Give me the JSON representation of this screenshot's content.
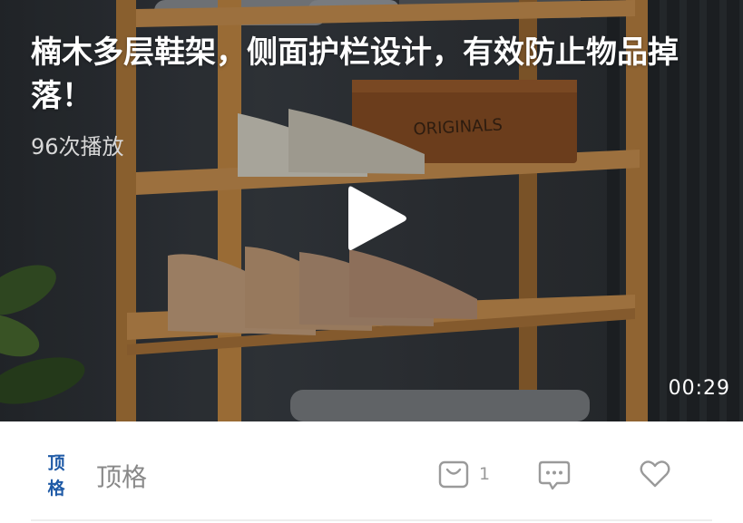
{
  "video": {
    "title": "楠木多层鞋架，侧面护栏设计，有效防止物品掉落！",
    "play_count": "96次播放",
    "duration": "00:29",
    "box_text": "ORIGINALS"
  },
  "bar": {
    "author_logo_top": "顶",
    "author_logo_bottom": "格",
    "author_name": "顶格",
    "cart_count": "1"
  },
  "colors": {
    "logo_blue": "#1f5aa6",
    "icon_gray": "#9a9a9a",
    "author_gray": "#888888"
  },
  "icons": {
    "play": "play-icon",
    "cart": "shopping-bag-icon",
    "comment": "comment-icon",
    "like": "heart-icon"
  }
}
